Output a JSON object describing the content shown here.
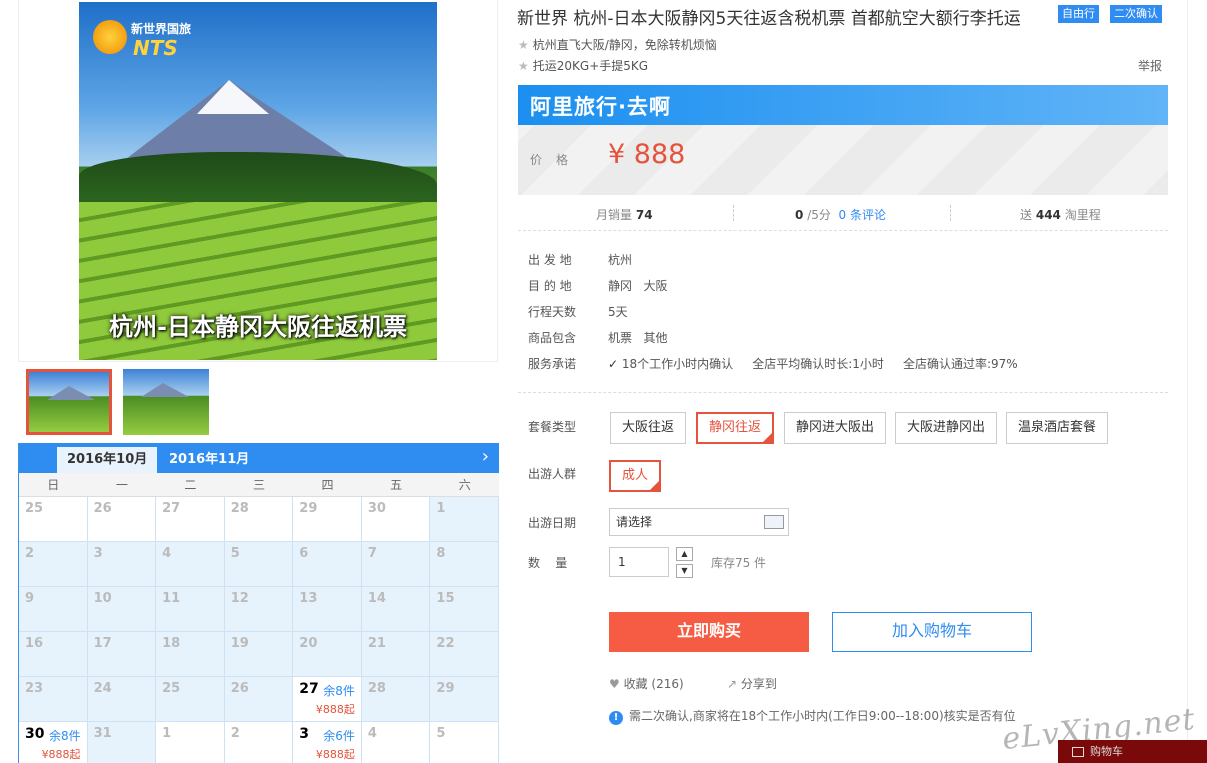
{
  "product": {
    "title": "新世界 杭州-日本大阪静冈5天往返含税机票 首都航空大额行李托运",
    "tags": [
      "自由行",
      "二次确认"
    ],
    "features": [
      "杭州直飞大阪/静冈，免除转机烦恼",
      "托运20KG+手提5KG"
    ],
    "report_label": "举报"
  },
  "images": {
    "logo_top": "新世界国旅",
    "logo_bottom": "NTS",
    "caption": "杭州-日本静冈大阪往返机票",
    "thumbnail_count": 2
  },
  "price": {
    "brand": "阿里旅行·去啊",
    "label": "价格",
    "value": "¥ 888"
  },
  "stats": {
    "sales_label": "月销量",
    "sales_value": "74",
    "rating_value": "0",
    "rating_suffix": "/5分",
    "reviews_link": "0 条评论",
    "points_prefix": "送",
    "points_value": "444",
    "points_suffix": "淘里程"
  },
  "info": [
    {
      "label": "出 发 地",
      "value": "杭州"
    },
    {
      "label": "目 的 地",
      "value": "静冈   大阪"
    },
    {
      "label": "行程天数",
      "value": "5天"
    },
    {
      "label": "商品包含",
      "value": "机票   其他"
    },
    {
      "label": "服务承诺",
      "value": "18个工作小时内确认     全店平均确认时长:1小时     全店确认通过率:97%"
    }
  ],
  "options": {
    "package_label": "套餐类型",
    "packages": [
      "大阪往返",
      "静冈往返",
      "静冈进大阪出",
      "大阪进静冈出",
      "温泉酒店套餐"
    ],
    "selected_package": "静冈往返",
    "traveler_label": "出游人群",
    "traveler": "成人",
    "date_label": "出游日期",
    "date_placeholder": "请选择",
    "qty_label": "数    量",
    "qty_value": "1",
    "stock_text": "库存75 件"
  },
  "actions": {
    "buy": "立即购买",
    "cart": "加入购物车",
    "favorite": "收藏 (216)",
    "share": "分享到"
  },
  "notice": "需二次确认,商家将在18个工作小时内(工作日9:00--18:00)核实是否有位",
  "calendar": {
    "tabs": [
      "2016年10月",
      "2016年11月"
    ],
    "weekdays": [
      "日",
      "一",
      "二",
      "三",
      "四",
      "五",
      "六"
    ],
    "cells": [
      {
        "d": "25",
        "w": true
      },
      {
        "d": "26",
        "w": true
      },
      {
        "d": "27",
        "w": true
      },
      {
        "d": "28",
        "w": true
      },
      {
        "d": "29",
        "w": true
      },
      {
        "d": "30",
        "w": true
      },
      {
        "d": "1"
      },
      {
        "d": "2"
      },
      {
        "d": "3"
      },
      {
        "d": "4"
      },
      {
        "d": "5"
      },
      {
        "d": "6"
      },
      {
        "d": "7"
      },
      {
        "d": "8"
      },
      {
        "d": "9"
      },
      {
        "d": "10"
      },
      {
        "d": "11"
      },
      {
        "d": "12"
      },
      {
        "d": "13"
      },
      {
        "d": "14"
      },
      {
        "d": "15"
      },
      {
        "d": "16"
      },
      {
        "d": "17"
      },
      {
        "d": "18"
      },
      {
        "d": "19"
      },
      {
        "d": "20"
      },
      {
        "d": "21"
      },
      {
        "d": "22"
      },
      {
        "d": "23"
      },
      {
        "d": "24"
      },
      {
        "d": "25"
      },
      {
        "d": "26"
      },
      {
        "d": "27",
        "stock": "余8件",
        "price": "¥888起",
        "w": true
      },
      {
        "d": "28"
      },
      {
        "d": "29"
      },
      {
        "d": "30",
        "stock": "余8件",
        "price": "¥888起",
        "w": true
      },
      {
        "d": "31"
      },
      {
        "d": "1",
        "w": true
      },
      {
        "d": "2",
        "w": true
      },
      {
        "d": "3",
        "stock": "余6件",
        "price": "¥888起",
        "w": true
      },
      {
        "d": "4",
        "w": true
      },
      {
        "d": "5",
        "w": true
      }
    ]
  },
  "watermark": "eLvXing.net",
  "mini_cart": "购物车",
  "colors": {
    "accent": "#2f8cf1",
    "price": "#e4533c",
    "buy": "#f55c43"
  }
}
